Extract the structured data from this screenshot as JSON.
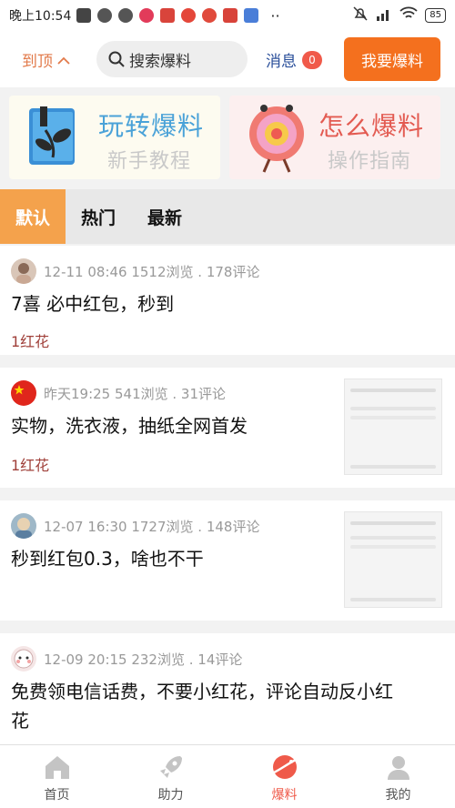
{
  "status_bar": {
    "time": "晚上10:54",
    "network": "4G",
    "battery": "85"
  },
  "header": {
    "to_top_label": "到顶",
    "search_placeholder": "搜索爆料",
    "messages_label": "消息",
    "messages_count": "0",
    "post_button_label": "我要爆料"
  },
  "banners": [
    {
      "title": "玩转爆料",
      "subtitle": "新手教程"
    },
    {
      "title": "怎么爆料",
      "subtitle": "操作指南"
    }
  ],
  "tabs": [
    {
      "label": "默认",
      "active": true
    },
    {
      "label": "热门",
      "active": false
    },
    {
      "label": "最新",
      "active": false
    }
  ],
  "feed": [
    {
      "meta": "12-11 08:46  1512浏览 . 178评论",
      "title": "7喜 必中红包，秒到",
      "flower": "1红花",
      "has_thumb": false
    },
    {
      "meta": "昨天19:25  541浏览 . 31评论",
      "title": "实物，洗衣液，抽纸全网首发",
      "flower": "1红花",
      "has_thumb": true
    },
    {
      "meta": "12-07 16:30  1727浏览 . 148评论",
      "title": "秒到红包0.3，啥也不干",
      "flower": "",
      "has_thumb": true
    },
    {
      "meta": "12-09 20:15  232浏览 . 14评论",
      "title_line1": "免费领电信话费，不要小红花，评论自动反小红",
      "title_line2": "花",
      "has_thumb": false
    }
  ],
  "bottom_nav": [
    {
      "label": "首页",
      "icon": "home-icon",
      "active": false
    },
    {
      "label": "助力",
      "icon": "rocket-icon",
      "active": false
    },
    {
      "label": "爆料",
      "icon": "planet-icon",
      "active": true
    },
    {
      "label": "我的",
      "icon": "user-icon",
      "active": false
    }
  ],
  "colors": {
    "accent_orange": "#f4701e",
    "tab_active": "#f4a24c",
    "nav_active": "#ef5a4a",
    "link_blue": "#2a4f9a"
  }
}
